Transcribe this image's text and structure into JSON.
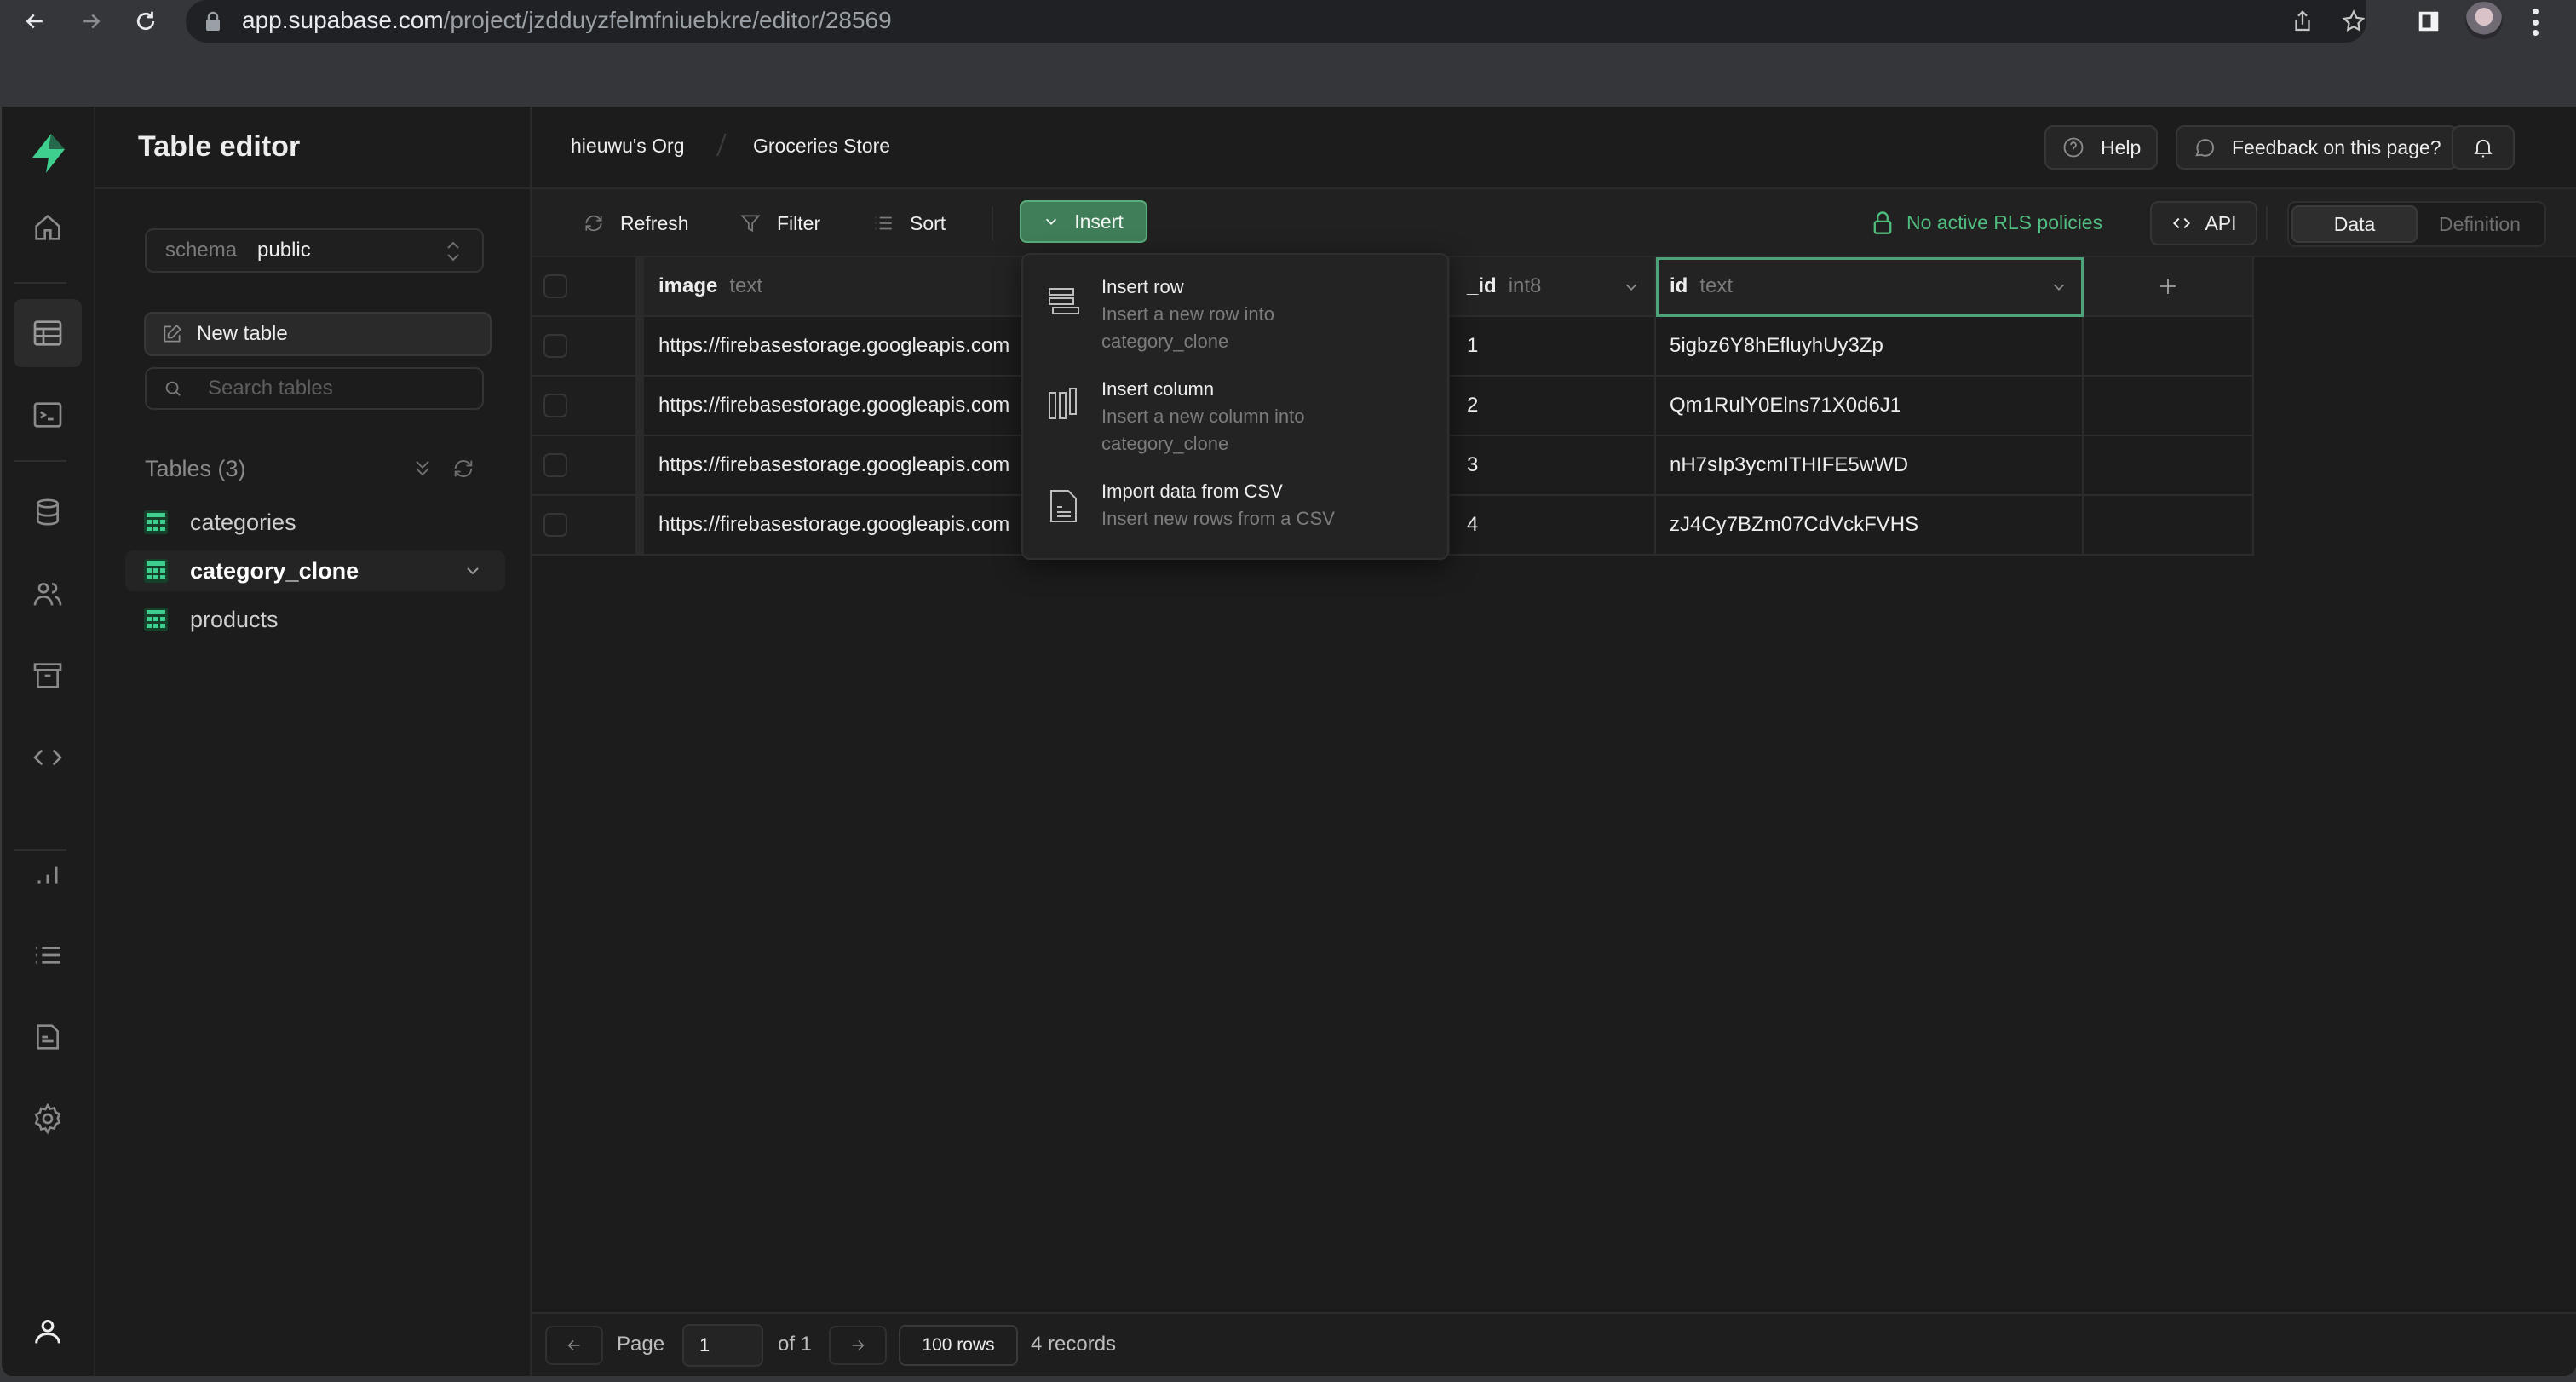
{
  "browser": {
    "url_host": "app.supabase.com",
    "url_path": "/project/jzdduyzfelmfniuebkre/editor/28569"
  },
  "rail": {
    "items": [
      "home",
      "table-editor",
      "sql-editor",
      "database",
      "authentication",
      "storage",
      "edge-functions",
      "reports",
      "logs",
      "api-docs",
      "settings"
    ],
    "active": "table-editor"
  },
  "sidebar": {
    "title": "Table editor",
    "schema_label": "schema",
    "schema_value": "public",
    "new_table_label": "New table",
    "search_placeholder": "Search tables",
    "tables_heading": "Tables (3)",
    "tables": [
      {
        "name": "categories",
        "active": false
      },
      {
        "name": "category_clone",
        "active": true
      },
      {
        "name": "products",
        "active": false
      }
    ]
  },
  "header": {
    "org": "hieuwu's Org",
    "project": "Groceries Store",
    "help_label": "Help",
    "feedback_label": "Feedback on this page?"
  },
  "toolbar": {
    "refresh_label": "Refresh",
    "filter_label": "Filter",
    "sort_label": "Sort",
    "insert_label": "Insert",
    "rls_label": "No active RLS policies",
    "api_label": "API",
    "view_data": "Data",
    "view_definition": "Definition",
    "active_view": "Data"
  },
  "insert_menu": {
    "items": [
      {
        "title": "Insert row",
        "description": "Insert a new row into category_clone",
        "icon": "rows-icon"
      },
      {
        "title": "Insert column",
        "description": "Insert a new column into category_clone",
        "icon": "columns-icon"
      },
      {
        "title": "Import data from CSV",
        "description": "Insert new rows from a CSV",
        "icon": "file-icon"
      }
    ]
  },
  "table": {
    "columns": [
      {
        "name": "image",
        "type": "text"
      },
      {
        "name": "",
        "type": ""
      },
      {
        "name": "_id",
        "type": "int8"
      },
      {
        "name": "id",
        "type": "text"
      }
    ],
    "rows": [
      {
        "image": "https://firebasestorage.googleapis.com",
        "_id": "1",
        "id": "5igbz6Y8hEfluyhUy3Zp"
      },
      {
        "image": "https://firebasestorage.googleapis.com",
        "_id": "2",
        "id": "Qm1RulY0Elns71X0d6J1"
      },
      {
        "image": "https://firebasestorage.googleapis.com",
        "_id": "3",
        "id": "nH7sIp3ycmITHIFE5wWD"
      },
      {
        "image": "https://firebasestorage.googleapis.com",
        "_id": "4",
        "id": "zJ4Cy7BZm07CdVckFVHS"
      }
    ]
  },
  "footer": {
    "page_label": "Page",
    "page_value": "1",
    "of_label": "of 1",
    "rows_label": "100 rows",
    "records_label": "4 records"
  },
  "colors": {
    "accent": "#3f7e59",
    "accent_border": "#5aae7e",
    "rls_green": "#4fbd7e",
    "background": "#1c1c1c"
  }
}
